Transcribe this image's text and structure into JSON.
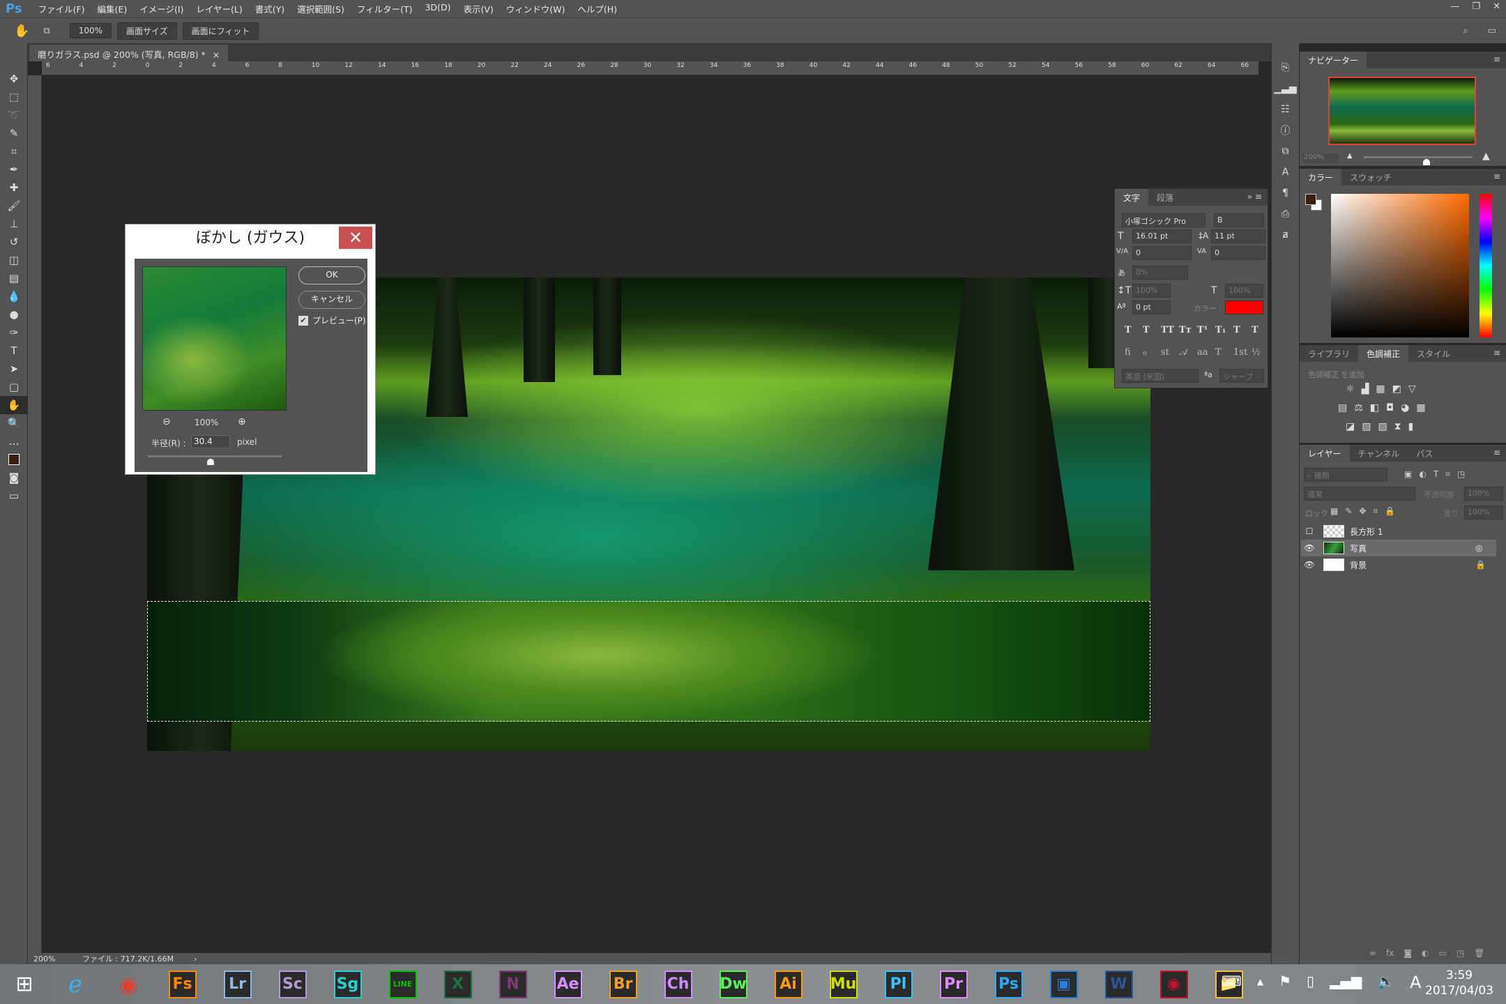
{
  "app": {
    "logo": "Ps",
    "menu": [
      "ファイル(F)",
      "編集(E)",
      "イメージ(I)",
      "レイヤー(L)",
      "書式(Y)",
      "選択範囲(S)",
      "フィルター(T)",
      "3D(D)",
      "表示(V)",
      "ウィンドウ(W)",
      "ヘルプ(H)"
    ],
    "window_controls": [
      "—",
      "❐",
      "✕"
    ]
  },
  "options": {
    "zoom": "100%",
    "fit_screen_size": "画面サイズ",
    "fit_screen": "画面にフィット"
  },
  "document": {
    "tab_title": "磨りガラス.psd @ 200% (写真, RGB/8) *",
    "close": "×"
  },
  "ruler": {
    "top_labels": [
      "6",
      "4",
      "2",
      "0",
      "2",
      "4",
      "6",
      "8",
      "10",
      "12",
      "14",
      "16",
      "18",
      "20",
      "22",
      "24",
      "26",
      "28",
      "30",
      "32",
      "34",
      "36",
      "38",
      "40",
      "42",
      "44",
      "46",
      "48",
      "50",
      "52",
      "54",
      "56",
      "58",
      "60",
      "62",
      "64",
      "66"
    ]
  },
  "dialog": {
    "title": "ぼかし (ガウス)",
    "close": "✕",
    "ok": "OK",
    "cancel": "キャンセル",
    "preview_label": "プレビュー(P)",
    "preview_checked": true,
    "zoom": "100%",
    "radius_label": "半径(R) :",
    "radius_value": "30.4",
    "radius_unit": "pixel",
    "slider_fraction": 0.47
  },
  "navigator": {
    "tab": "ナビゲーター",
    "zoom": "200%",
    "slider_fraction": 0.58
  },
  "color": {
    "tabs": [
      "カラー",
      "スウォッチ"
    ],
    "foreground": "#3a1e12",
    "background": "#ffffff"
  },
  "adjustments": {
    "tabs": [
      "ライブラリ",
      "色調補正",
      "スタイル"
    ],
    "add_label": "色調補正 を追加"
  },
  "character": {
    "tabs": [
      "文字",
      "段落"
    ],
    "font": "小塚ゴシック Pro",
    "style": "B",
    "size": "16.01 pt",
    "leading": "11 pt",
    "kerning": "0",
    "tracking": "0",
    "tsume": "0%",
    "vscale": "100%",
    "hscale": "100%",
    "baseline": "0 pt",
    "color_label": "カラー :",
    "color": "#ff0000",
    "language": "英語 (米国)",
    "antialias": "シャープ",
    "type_styles": [
      "T",
      "T",
      "TT",
      "Tт",
      "T¹",
      "T₁",
      "T",
      "T"
    ],
    "opentype": [
      "ﬁ",
      "ℴ",
      "st",
      "𝒜",
      "aa",
      "T",
      "1st",
      "½"
    ]
  },
  "layers": {
    "tabs": [
      "レイヤー",
      "チャンネル",
      "パス"
    ],
    "filter": "種類",
    "blend": "通常",
    "opacity_label": "不透明度 :",
    "opacity": "100%",
    "lock_label": "ロック :",
    "fill_label": "塗り :",
    "fill": "100%",
    "items": [
      {
        "name": "長方形 1",
        "visible": false
      },
      {
        "name": "写真",
        "visible": true,
        "selected": true
      },
      {
        "name": "背景",
        "visible": true,
        "locked": true
      }
    ]
  },
  "status": {
    "zoom": "200%",
    "file": "ファイル : 717.2K/1.66M"
  },
  "taskbar": {
    "apps": [
      {
        "label": "Fs",
        "color": "#ff8a00"
      },
      {
        "label": "Lr",
        "color": "#8fb8e0"
      },
      {
        "label": "Sc",
        "color": "#b49ad6"
      },
      {
        "label": "Sg",
        "color": "#2ad0d0"
      },
      {
        "label": "LINE",
        "color": "#00c300"
      },
      {
        "label": "X",
        "color": "#1e7145"
      },
      {
        "label": "N",
        "color": "#80397b"
      },
      {
        "label": "Ae",
        "color": "#d291ff"
      },
      {
        "label": "Br",
        "color": "#f0a020"
      },
      {
        "label": "Ch",
        "color": "#d08cff"
      },
      {
        "label": "Dw",
        "color": "#5cf05c"
      },
      {
        "label": "Ai",
        "color": "#ff9a00"
      },
      {
        "label": "Mu",
        "color": "#cfe000"
      },
      {
        "label": "Pl",
        "color": "#3ac0ff"
      },
      {
        "label": "Pr",
        "color": "#e08cff"
      },
      {
        "label": "Ps",
        "color": "#31a8ff"
      },
      {
        "label": "▣",
        "color": "#2b7cd3"
      },
      {
        "label": "W",
        "color": "#2b579a"
      },
      {
        "label": "◉",
        "color": "#c8102e"
      },
      {
        "label": "📁",
        "color": "#f0c040"
      }
    ],
    "time": "3:59",
    "date": "2017/04/03",
    "ime": "A"
  }
}
